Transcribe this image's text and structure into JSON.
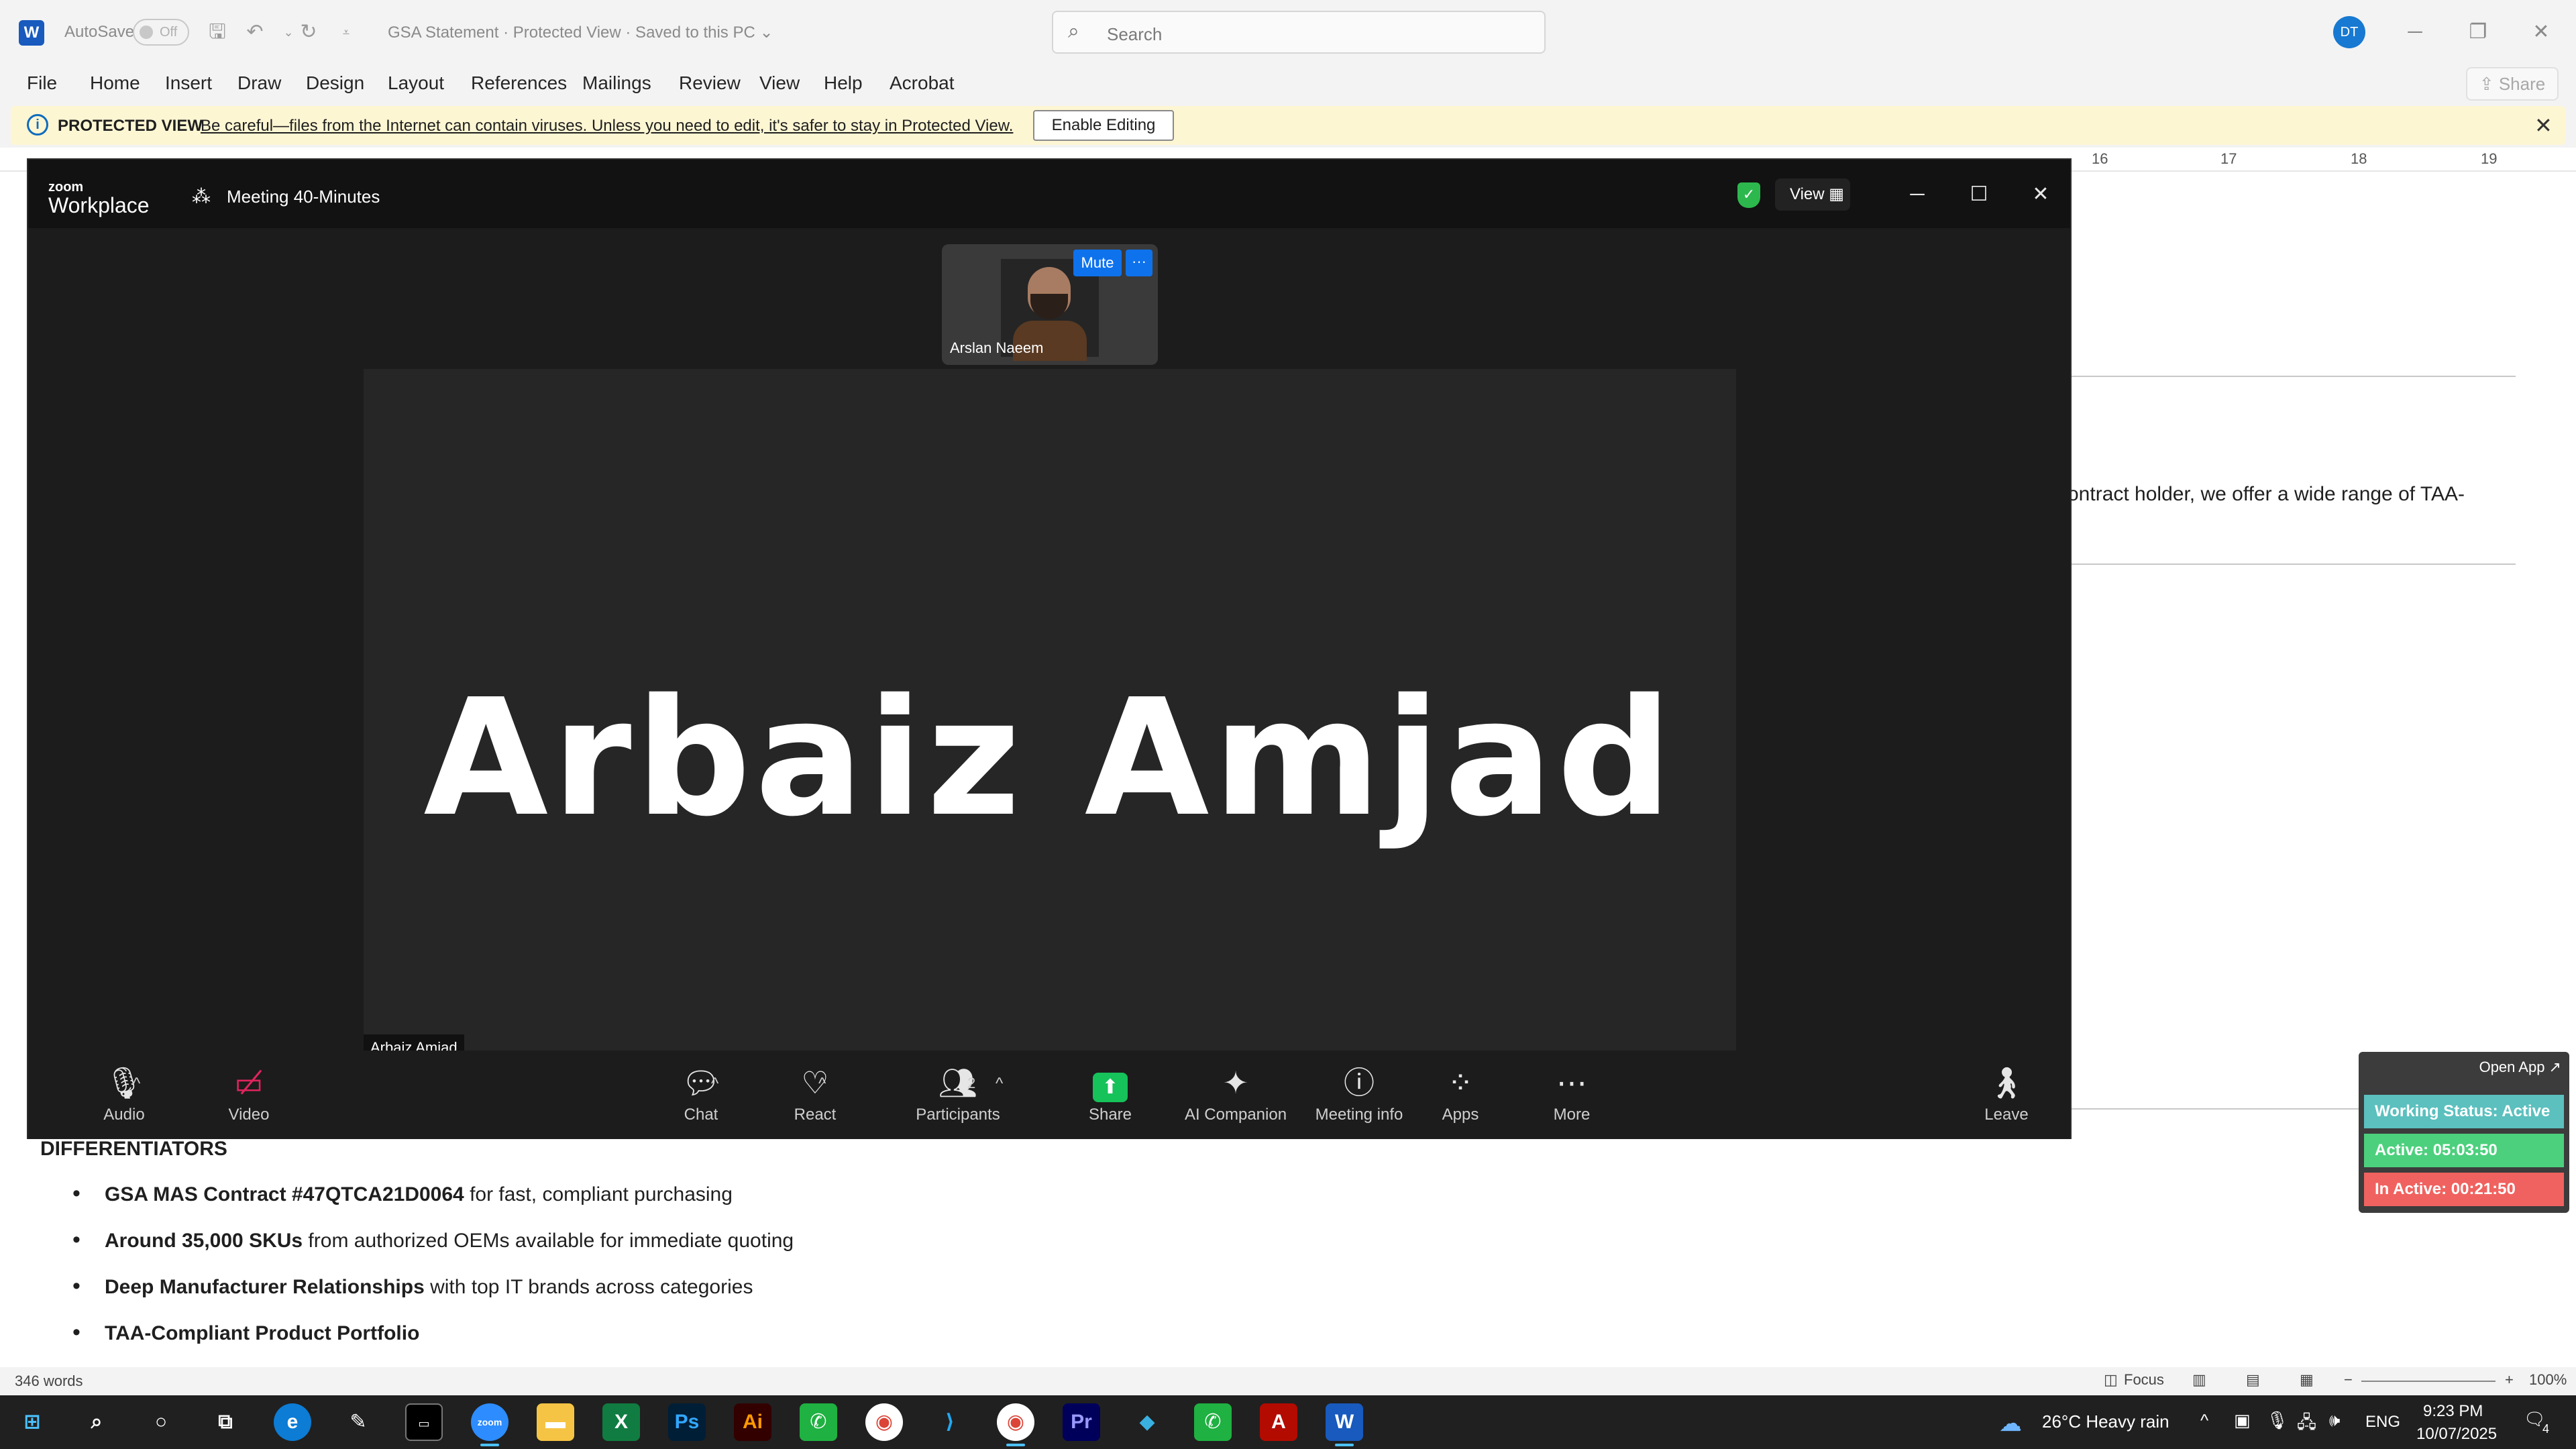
{
  "word": {
    "app_letter": "W",
    "autosave_label": "AutoSave",
    "autosave_state": "Off",
    "doc_title": "GSA Statement  ·  Protected View  ·  Saved to this PC ⌄",
    "search_placeholder": "Search",
    "user_initials": "DT",
    "share_label": "Share",
    "ribbon_tabs": [
      "File",
      "Home",
      "Insert",
      "Draw",
      "Design",
      "Layout",
      "References",
      "Mailings",
      "Review",
      "View",
      "Help",
      "Acrobat"
    ],
    "protected_view": {
      "title": "PROTECTED VIEW",
      "message": "Be careful—files from the Internet can contain viruses. Unless you need to edit, it's safer to stay in Protected View.",
      "button": "Enable Editing"
    },
    "ruler_numbers": [
      "16",
      "17",
      "18",
      "19"
    ],
    "partial_text": "ontract holder, we offer a wide range of TAA-",
    "heading": "DIFFERENTIATORS",
    "bullets": [
      {
        "bold": "GSA MAS Contract #47QTCA21D0064",
        "rest": " for fast, compliant purchasing"
      },
      {
        "bold": "Around 35,000 SKUs",
        "rest": " from authorized OEMs available for immediate quoting"
      },
      {
        "bold": "Deep Manufacturer Relationships",
        "rest": " with top IT brands across categories"
      },
      {
        "bold": "TAA-Compliant Product Portfolio",
        "rest": ""
      }
    ],
    "status": {
      "word_count": "346 words",
      "focus": "Focus",
      "zoom": "100%"
    }
  },
  "zoom": {
    "logo_small": "zoom",
    "logo_big": "Workplace",
    "meeting_title": "Meeting 40-Minutes",
    "view_label": "View",
    "thumbnail": {
      "name": "Arslan Naeem",
      "mute_label": "Mute",
      "more_label": "···"
    },
    "main_speaker": "Arbaiz Amjad",
    "main_label": "Arbaiz Amjad",
    "participants_count": "2",
    "toolbar": {
      "audio": "Audio",
      "video": "Video",
      "chat": "Chat",
      "react": "React",
      "participants": "Participants",
      "share": "Share",
      "ai_companion": "AI Companion",
      "meeting_info": "Meeting info",
      "apps": "Apps",
      "more": "More",
      "leave": "Leave"
    }
  },
  "status_widget": {
    "open_app": "Open App ↗",
    "working_status": "Working Status: Active",
    "active": "Active: 05:03:50",
    "inactive": "In Active: 00:21:50",
    "colors": {
      "working": "#5bc0be",
      "active": "#4cd07d",
      "inactive": "#f0625f"
    }
  },
  "taskbar": {
    "weather": "26°C  Heavy rain",
    "language": "ENG",
    "time": "9:23 PM",
    "date": "10/07/2025",
    "notification_count": "4"
  }
}
